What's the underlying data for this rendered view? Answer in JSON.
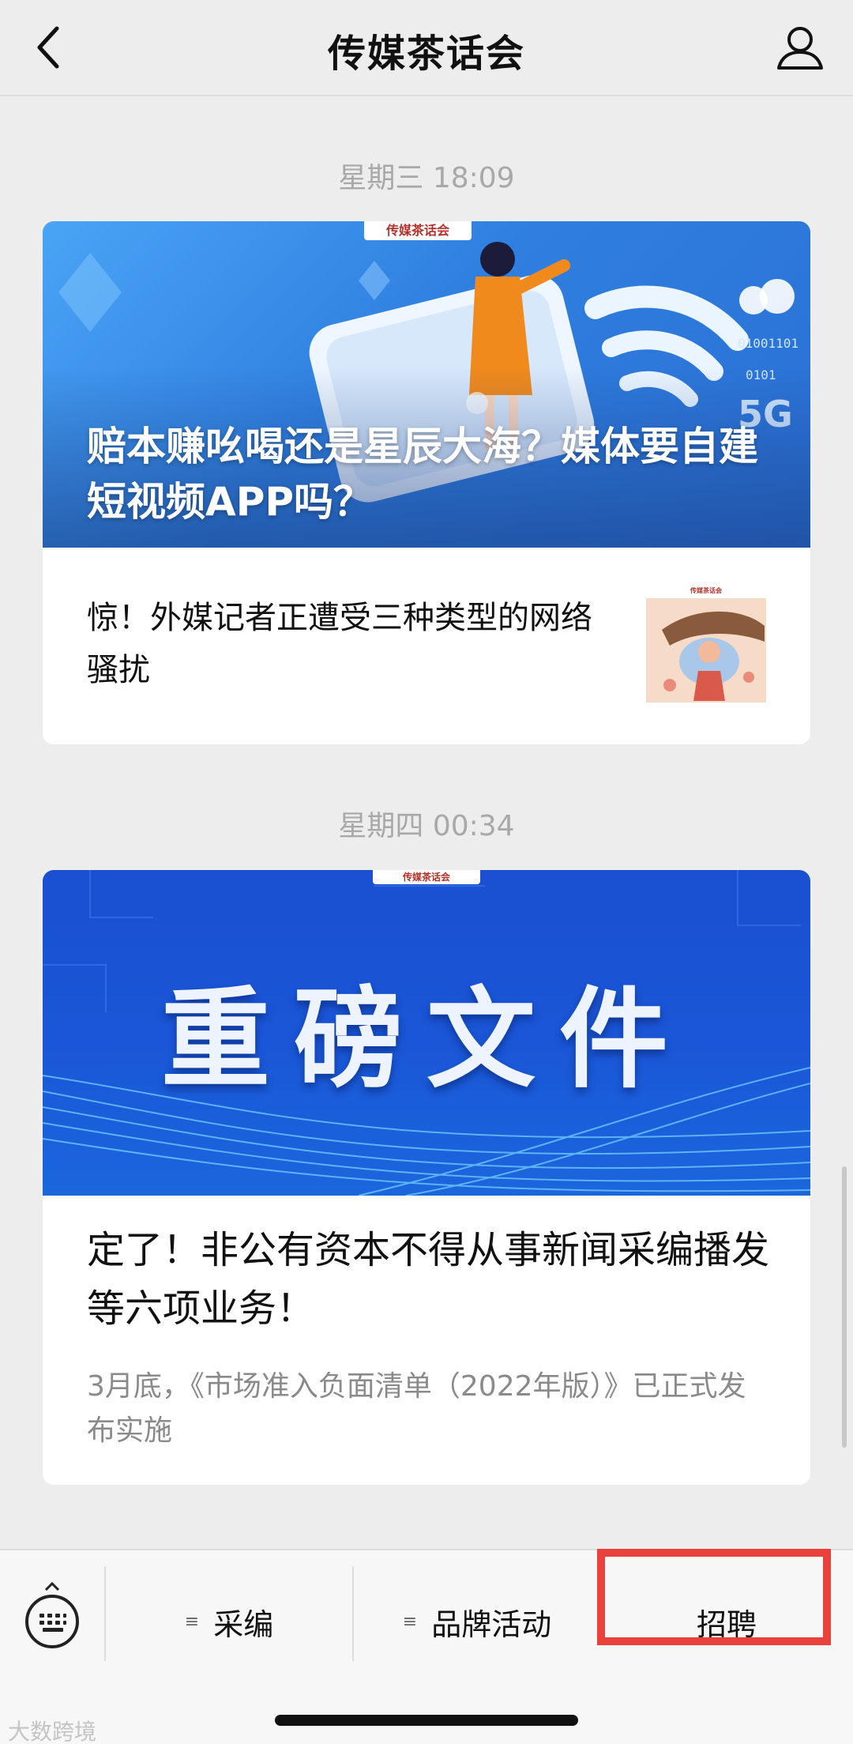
{
  "header": {
    "title": "传媒茶话会",
    "back_icon": "chevron-left-icon",
    "profile_icon": "person-icon"
  },
  "feed": [
    {
      "timestamp": "星期三 18:09",
      "brand_tag": "传媒茶话会",
      "headline": "赔本赚吆喝还是星辰大海？媒体要自建短视频APP吗？",
      "sub_article": {
        "title": "惊！外媒记者正遭受三种类型的网络骚扰",
        "thumb_brand_tag": "传媒茶话会"
      }
    },
    {
      "timestamp": "星期四 00:34",
      "brand_tag": "传媒茶话会",
      "banner_text": "重磅文件",
      "title": "定了！非公有资本不得从事新闻采编播发等六项业务！",
      "description": "3月底，《市场准入负面清单（2022年版）》已正式发布实施"
    }
  ],
  "bottom_menu": {
    "keyboard_icon": "keyboard-icon",
    "items": [
      {
        "label": "采编",
        "glyph": "≡"
      },
      {
        "label": "品牌活动",
        "glyph": "≡"
      },
      {
        "label": "招聘"
      }
    ],
    "highlight_color": "#e9413c"
  },
  "watermark": "大数跨境"
}
